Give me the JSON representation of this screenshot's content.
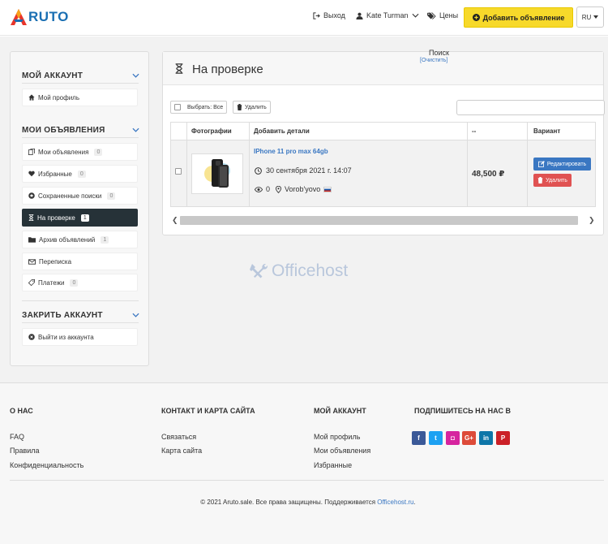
{
  "header": {
    "logo_text": "RUTO",
    "logout_label": "Выход",
    "user_name": "Kate Turman",
    "prices_label": "Цены",
    "add_button_label": "Добавить объявление",
    "language": "RU"
  },
  "sidebar": {
    "account_title": "МОЙ АККАУНТ",
    "profile_label": "Мой профиль",
    "ads_title": "МОИ ОБЪЯВЛЕНИЯ",
    "items": [
      {
        "label": "Мои объявления",
        "count": "0"
      },
      {
        "label": "Избранные",
        "count": "0"
      },
      {
        "label": "Сохраненные поиски",
        "count": "0"
      },
      {
        "label": "На проверке",
        "count": "1"
      },
      {
        "label": "Архив объявлений",
        "count": "1"
      },
      {
        "label": "Переписка",
        "count": ""
      },
      {
        "label": "Платежи",
        "count": "0"
      }
    ],
    "close_title": "ЗАКРИТЬ АККАУНТ",
    "logout_label": "Выйти из аккаунта"
  },
  "main": {
    "title": "На проверке",
    "select_all_label": "Выбрать: Все",
    "delete_label": "Удалить",
    "search_label": "Поиск",
    "clear_label": "[Очистить]",
    "columns": [
      "Фотографии",
      "Добавить детали",
      "--",
      "Вариант"
    ],
    "row": {
      "title": "IPhone 11 pro max 64gb",
      "date": "30 сентября 2021 г. 14:07",
      "views": "0",
      "location": "Vorob'yovo",
      "price": "48,500 ₽",
      "edit_label": "Редактировать",
      "delete_label": "Удалить"
    }
  },
  "watermark": "Officehost",
  "footer": {
    "about_title": "О НАС",
    "about_links": [
      "FAQ",
      "Правила",
      "Конфиденциальность"
    ],
    "contact_title": "КОНТАКТ И КАРТА САЙТА",
    "contact_links": [
      "Связаться",
      "Карта сайта"
    ],
    "account_title": "МОЙ АККАУНТ",
    "account_links": [
      "Мой профиль",
      "Мои объявления",
      "Избранные"
    ],
    "social_title": "ПОДПИШИТЕСЬ НА НАС В",
    "social": [
      {
        "name": "facebook-icon",
        "glyph": "f",
        "color": "#3b5998"
      },
      {
        "name": "twitter-icon",
        "glyph": "t",
        "color": "#1da1f2"
      },
      {
        "name": "instagram-icon",
        "glyph": "◘",
        "color": "#d6249f"
      },
      {
        "name": "google-plus-icon",
        "glyph": "G+",
        "color": "#dd4b39"
      },
      {
        "name": "linkedin-icon",
        "glyph": "in",
        "color": "#0e76a8"
      },
      {
        "name": "pinterest-icon",
        "glyph": "P",
        "color": "#cb2027"
      }
    ],
    "copyright_text": "© 2021 Aruto.sale. Все права защищены. Поддерживается ",
    "copyright_link": "Officehost.ru",
    "copyright_end": "."
  }
}
